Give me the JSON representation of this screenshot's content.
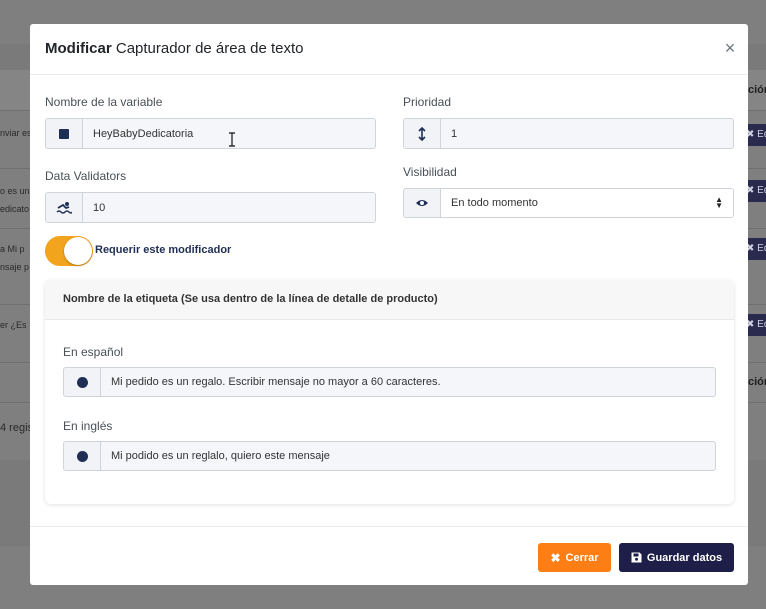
{
  "background": {
    "headers": [
      "ción",
      "ción"
    ],
    "rows": [
      {
        "text": "nviar es",
        "btn": "✖ Ed"
      },
      {
        "text": "o es un",
        "text2": "edicato",
        "btn": "✖ Ed"
      },
      {
        "text": "a Mi p",
        "text2": "nsaje p",
        "btn": "✖ Ed"
      },
      {
        "text": "er ¿Es",
        "btn": "✖ Ed"
      }
    ],
    "footer_text": "4 regis"
  },
  "modal": {
    "title_bold": "Modificar",
    "title_rest": " Capturador de área de texto",
    "close_glyph": "×",
    "variable_name": {
      "label": "Nombre de la variable",
      "value": "HeyBabyDedicatoria"
    },
    "priority": {
      "label": "Prioridad",
      "value": "1"
    },
    "validators": {
      "label": "Data Validators",
      "value": "10"
    },
    "visibility": {
      "label": "Visibilidad",
      "selected": "En todo momento"
    },
    "required_toggle": {
      "label": "Requerir este modificador",
      "on": true
    },
    "tag_card": {
      "title": "Nombre de la etiqueta (Se usa dentro de la línea de detalle de producto)",
      "spanish": {
        "label": "En español",
        "value": "Mi pedido es un regalo. Escribir mensaje no mayor a 60 caracteres."
      },
      "english": {
        "label": "En inglés",
        "value": "Mi podido es un reglalo, quiero este mensaje"
      }
    },
    "buttons": {
      "close": "Cerrar",
      "save": "Guardar datos"
    }
  },
  "colors": {
    "accent_orange": "#fd7e14",
    "toggle_on": "#f2a41c",
    "primary_dark": "#1e1f48",
    "icon_navy": "#1f2e55"
  }
}
